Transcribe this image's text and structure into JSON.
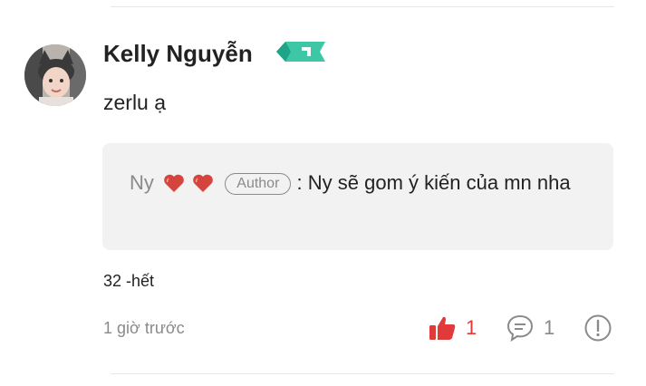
{
  "comment": {
    "author_name": "Kelly Nguyễn",
    "text": "zerlu ạ",
    "reply": {
      "author": "Ny",
      "tag": "Author",
      "separator": ":",
      "text": "Ny sẽ gom ý kiến của mn nha"
    },
    "extra_line": "32 -hết",
    "timestamp": "1 giờ trước",
    "likes": "1",
    "replies": "1"
  },
  "icons": {
    "avatar": "user-avatar-photo",
    "badge": "rank-badge-icon",
    "heart": "heart-emoji-icon",
    "like": "thumbs-up-icon",
    "reply": "comment-bubble-icon",
    "report": "exclamation-circle-icon"
  },
  "colors": {
    "like_active": "#e03a3a",
    "muted": "#8a8a8a",
    "badge": "#3ec7a6",
    "reply_bg": "#f2f2f2"
  }
}
